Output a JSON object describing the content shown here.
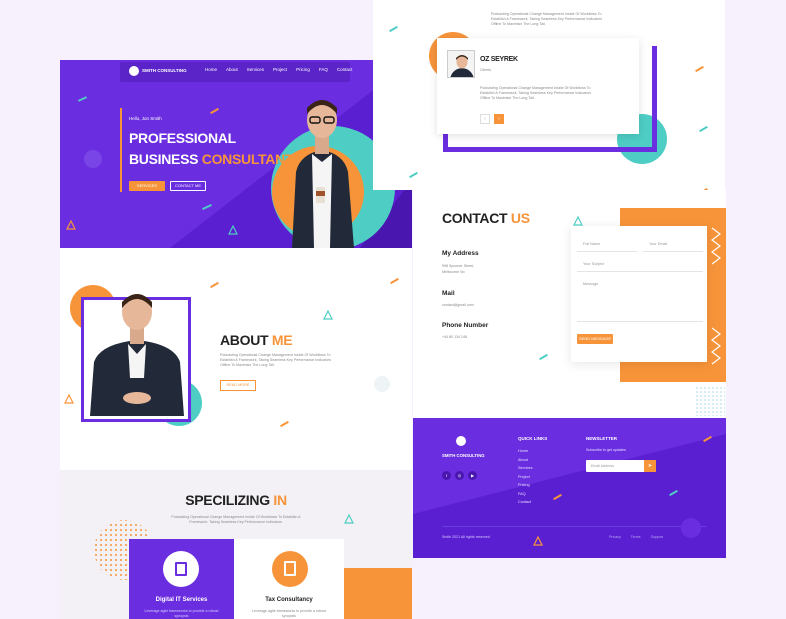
{
  "brand": {
    "name": "SMITH CONSULTING"
  },
  "nav": {
    "items": [
      "Home",
      "About",
      "Services",
      "Project",
      "Pricing",
      "FAQ",
      "Contact"
    ]
  },
  "hero": {
    "greeting": "Hello, Jon Smith",
    "title_line1": "PROFESSIONAL",
    "title_line2_white": "BUSINESS ",
    "title_line2_orange": "CONSULTANT",
    "primary_btn": "SERVICES",
    "secondary_btn": "CONTACT ME"
  },
  "about": {
    "title_dark": "ABOUT ",
    "title_accent": "ME",
    "body": "Podcasting Operational Change Management Inside Of Workflows To Establish A Framework. Taking Seamless Key Performance Indicators Offline To Maximise The Long Tail.",
    "btn": "READ MORE"
  },
  "specializing": {
    "title_dark": "SPECILIZING ",
    "title_accent": "IN",
    "body": "Podcasting Operational Change Management Inside Of Workflows To Establish A Framework. Taking Seamless Key Performance Indicators.",
    "cards": [
      {
        "title": "Digital IT Services",
        "desc": "Leverage agile frameworks to provide a robust synopsis"
      },
      {
        "title": "Tax Consultancy",
        "desc": "Leverage agile frameworks to provide a robust synopsis"
      }
    ]
  },
  "team": {
    "intro": "Podcasting Operational Change Management Inside Of Workflows To Establish A Framework. Taking Seamless Key Performance Indicators Offline To Maximise The Long Tail.",
    "name": "OZ SEYREK",
    "role": "Clients",
    "quote": "Podcasting Operational Change Management Inside Of Workflows To Establish A Framework. Taking Seamless Key Performance Indicators Offline To Maximise The Long Tail."
  },
  "contact": {
    "title_dark": "CONTACT ",
    "title_accent": "US",
    "address_label": "My Address",
    "address_value_1": "998 Spooner Street,",
    "address_value_2": "Melbourne Vic",
    "mail_label": "Mail",
    "mail_value": "contact@gmail.com",
    "phone_label": "Phone Number",
    "phone_value": "+44 80 134 248",
    "form": {
      "name_placeholder": "Full Name",
      "email_placeholder": "Your Email",
      "subject_placeholder": "Your Subject",
      "message_placeholder": "Message",
      "submit": "SEND MESSAGE"
    }
  },
  "footer": {
    "brand": "SMITH CONSULTING",
    "quick_links_title": "QUICK LINKS",
    "quick_links": [
      "Home",
      "About",
      "Services",
      "Project",
      "Pricing",
      "FAQ",
      "Contact"
    ],
    "newsletter_title": "NEWSLETTER",
    "newsletter_text": "Subscribe to get updates",
    "email_placeholder": "Email Address",
    "copyright": "Smith 2021 All rights reserved",
    "bottom_links": [
      "Privacy",
      "Terms",
      "Support"
    ]
  },
  "colors": {
    "purple": "#6a2ee0",
    "orange": "#f7943a",
    "teal": "#4ecdc4"
  }
}
